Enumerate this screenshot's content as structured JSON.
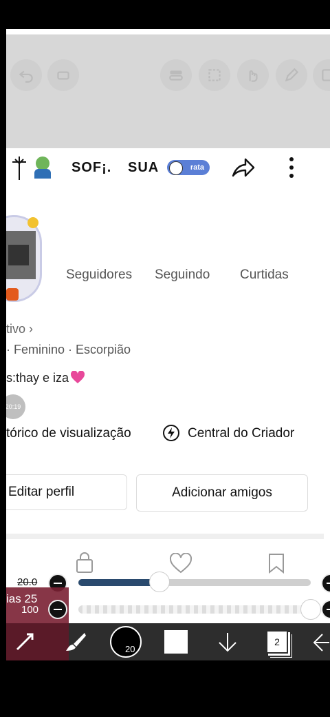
{
  "profile_bar": {
    "name1": "SOF¡.",
    "name2": "SUA",
    "badge_label": "rata"
  },
  "stats": {
    "followers_label": "Seguidores",
    "following_label": "Seguindo",
    "likes_label": "Curtidas"
  },
  "info": {
    "active_link": "tivo ›",
    "details": "· Feminino · Escorpião",
    "bio": "s:thay e iza",
    "time_badge": "20:19"
  },
  "links": {
    "history": "tórico de visualização",
    "creator_center": "Central do Criador"
  },
  "buttons": {
    "edit_profile": "Editar perfil",
    "add_friends": "Adicionar amigos"
  },
  "editor": {
    "slider1_value_label": "20.0",
    "slider1_fraction": 0.35,
    "slider2_value_label": "100",
    "slider2_fraction": 1.0,
    "layer_label": "ias 25",
    "brush_size": "20",
    "layer_count": "2"
  },
  "colors": {
    "toolbar_bg": "#d7d7d7",
    "slider_fill": "#2a4a6e",
    "bottom_bar": "#2d2d2d"
  }
}
